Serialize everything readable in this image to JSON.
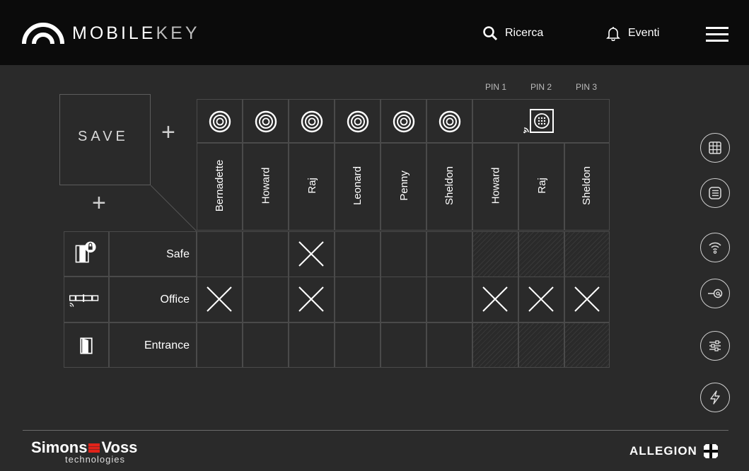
{
  "header": {
    "brand_bold": "MOBILE",
    "brand_light": "KEY",
    "search_label": "Ricerca",
    "events_label": "Eventi"
  },
  "matrix": {
    "save_label": "SAVE",
    "plus_symbol": "+",
    "pin_labels": [
      "PIN 1",
      "PIN 2",
      "PIN 3"
    ],
    "people": [
      "Bernadette",
      "Howard",
      "Raj",
      "Leonard",
      "Penny",
      "Sheldon",
      "Howard",
      "Raj",
      "Sheldon"
    ],
    "doors": [
      {
        "label": "Safe",
        "icon": "door-lock-icon"
      },
      {
        "label": "Office",
        "icon": "cylinder-icon"
      },
      {
        "label": "Entrance",
        "icon": "door-icon"
      }
    ],
    "authorizations": [
      [
        false,
        false,
        true,
        false,
        false,
        false,
        null,
        null,
        null
      ],
      [
        true,
        false,
        true,
        false,
        false,
        false,
        true,
        true,
        true
      ],
      [
        false,
        false,
        false,
        false,
        false,
        false,
        null,
        null,
        null
      ]
    ],
    "column_icons": [
      "transponder-icon",
      "transponder-icon",
      "transponder-icon",
      "transponder-icon",
      "transponder-icon",
      "transponder-icon",
      "pin-keypad-icon"
    ]
  },
  "sidebar": {
    "buttons": [
      "grid-icon",
      "list-icon",
      "wireless-icon",
      "key-at-icon",
      "settings-sliders-icon",
      "lightning-icon"
    ]
  },
  "footer": {
    "sv_left": "Simons",
    "sv_right": "Voss",
    "sv_sub": "technologies",
    "allegion": "ALLEGION"
  }
}
